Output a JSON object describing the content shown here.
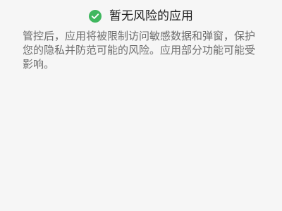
{
  "status": {
    "icon": "check-circle-icon",
    "icon_color": "#3fb75f",
    "title": "暂无风险的应用"
  },
  "description": "管控后，应用将被限制访问敏感数据和弹窗，保护您的隐私并防范可能的风险。应用部分功能可能受影响。"
}
